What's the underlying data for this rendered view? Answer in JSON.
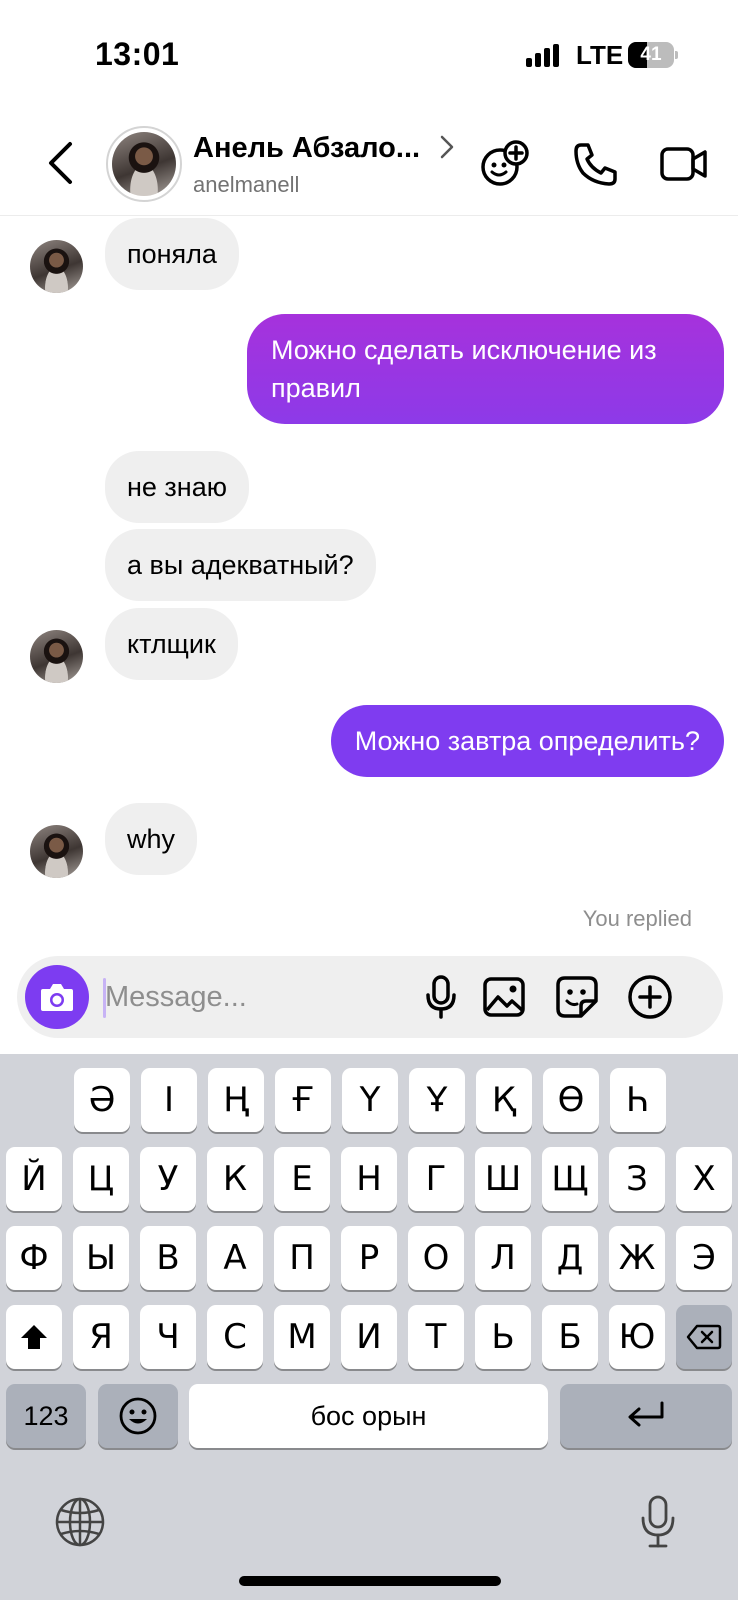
{
  "status_bar": {
    "time": "13:01",
    "network": "LTE",
    "battery_level": "41",
    "battery_fraction": 0.41
  },
  "header": {
    "contact_name": "Анель Абзало...",
    "username": "anelmanell",
    "icons": [
      "back-chevron-icon",
      "add-people-icon",
      "phone-icon",
      "video-camera-icon"
    ]
  },
  "messages": [
    {
      "side": "incoming",
      "text": "поняла",
      "avatar": true
    },
    {
      "side": "outgoing",
      "text": "Можно сделать исключение из правил"
    },
    {
      "side": "incoming",
      "text": "не знаю",
      "avatar": false
    },
    {
      "side": "incoming",
      "text": "а вы адекватный?",
      "avatar": false
    },
    {
      "side": "incoming",
      "text": "ктлщик",
      "avatar": true
    },
    {
      "side": "outgoing",
      "text": "Можно завтра определить?"
    },
    {
      "side": "incoming",
      "text": "why",
      "avatar": true
    }
  ],
  "replied_label": "You replied",
  "composer": {
    "placeholder": "Message...",
    "icons": [
      "camera-icon",
      "microphone-icon",
      "gallery-icon",
      "sticker-icon",
      "add-circle-icon"
    ]
  },
  "colors": {
    "accent": "#7d3cf1",
    "bubble_incoming": "#efefef",
    "outgoing_gradient_top": "#a632dc",
    "outgoing_gradient_bottom": "#8d3ae8",
    "outgoing_single": "#7f3cf0",
    "keyboard_bg": "#d1d3d9"
  },
  "keyboard": {
    "row1": [
      "Ә",
      "І",
      "Ң",
      "Ғ",
      "Ү",
      "Ұ",
      "Қ",
      "Ө",
      "Һ"
    ],
    "row2": [
      "Й",
      "Ц",
      "У",
      "К",
      "Е",
      "Н",
      "Г",
      "Ш",
      "Щ",
      "З",
      "Х"
    ],
    "row3": [
      "Ф",
      "Ы",
      "В",
      "А",
      "П",
      "Р",
      "О",
      "Л",
      "Д",
      "Ж",
      "Э"
    ],
    "row4": [
      "Я",
      "Ч",
      "С",
      "М",
      "И",
      "Т",
      "Ь",
      "Б",
      "Ю"
    ],
    "numbers_label": "123",
    "space_label": "бос орын",
    "icons": [
      "shift-icon",
      "backspace-icon",
      "emoji-icon",
      "return-icon",
      "globe-icon",
      "dictation-mic-icon"
    ]
  }
}
